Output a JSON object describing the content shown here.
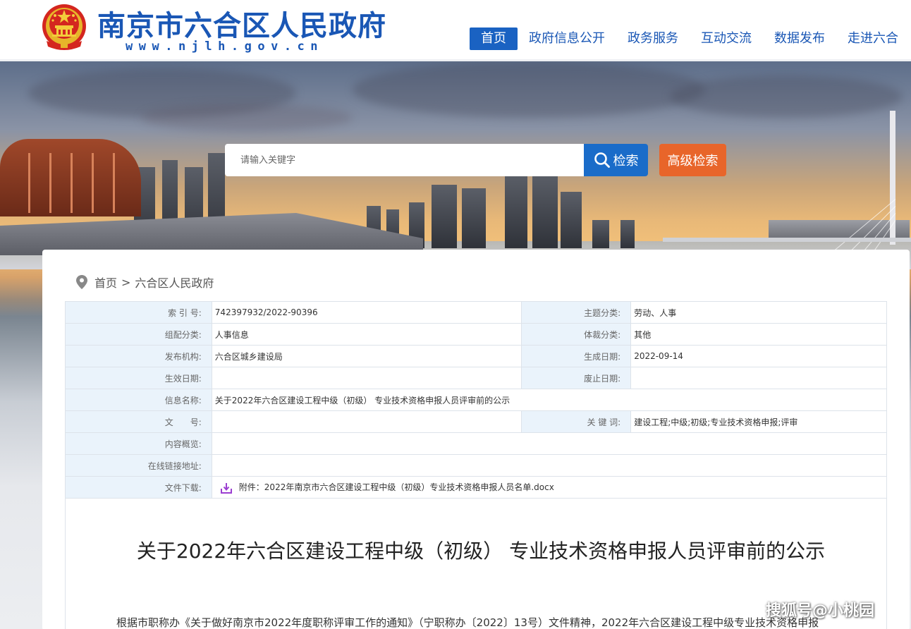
{
  "header": {
    "title": "南京市六合区人民政府",
    "url": "www.njlh.gov.cn",
    "nav": [
      {
        "label": "首页",
        "active": true
      },
      {
        "label": "政府信息公开",
        "active": false
      },
      {
        "label": "政务服务",
        "active": false
      },
      {
        "label": "互动交流",
        "active": false
      },
      {
        "label": "数据发布",
        "active": false
      },
      {
        "label": "走进六合",
        "active": false
      }
    ]
  },
  "search": {
    "placeholder": "请输入关键字",
    "button_label": "检索",
    "advanced_label": "高级检索"
  },
  "breadcrumb": {
    "home": "首页",
    "separator": ">",
    "current": "六合区人民政府"
  },
  "info": {
    "index_label": "索 引 号:",
    "index_value": "742397932/2022-90396",
    "topic_label": "主题分类:",
    "topic_value": "劳动、人事",
    "category_label": "组配分类:",
    "category_value": "人事信息",
    "genre_label": "体裁分类:",
    "genre_value": "其他",
    "publisher_label": "发布机构:",
    "publisher_value": "六合区城乡建设局",
    "created_label": "生成日期:",
    "created_value": "2022-09-14",
    "effective_label": "生效日期:",
    "effective_value": "",
    "expire_label": "废止日期:",
    "expire_value": "",
    "name_label": "信息名称:",
    "name_value": "关于2022年六合区建设工程中级（初级） 专业技术资格申报人员评审前的公示",
    "docno_label": "文　　号:",
    "docno_value": "",
    "keywords_label": "关 键 词:",
    "keywords_value": "建设工程;中级;初级;专业技术资格申报;评审",
    "summary_label": "内容概览:",
    "summary_value": "",
    "link_label": "在线链接地址:",
    "link_value": "",
    "download_label": "文件下载:",
    "download_value": "附件：2022年南京市六合区建设工程中级（初级）专业技术资格申报人员名单.docx"
  },
  "article": {
    "title": "关于2022年六合区建设工程中级（初级） 专业技术资格申报人员评审前的公示",
    "body_start": "根据市职称办《关于做好南京市2022年度职称评审工作的通知》（宁职称办〔2022〕13号）文件精神，2022年六合区建设工程中级专业技术资格申报"
  },
  "watermark": "搜狐号@小桃园",
  "colors": {
    "brand_blue": "#1a57b5",
    "search_blue": "#1a6cc9",
    "advanced_orange": "#e8652a",
    "label_bg": "#eaf3fb",
    "download_icon": "#9b3fd1"
  }
}
